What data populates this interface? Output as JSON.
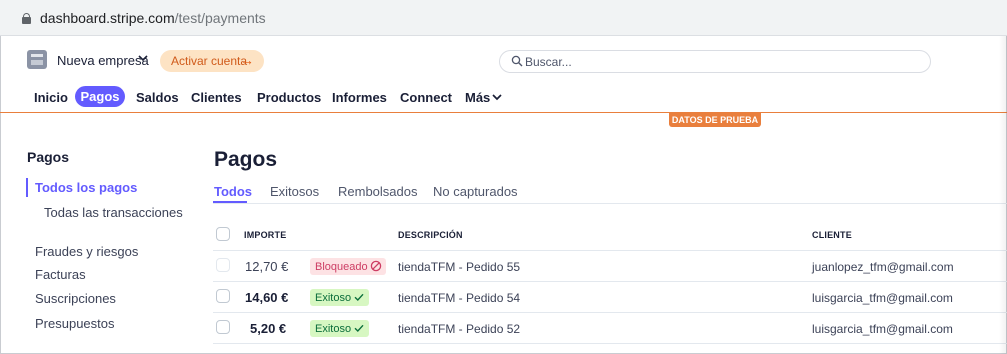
{
  "browser": {
    "url_host": "dashboard.stripe.com",
    "url_path": "/test/payments"
  },
  "topbar": {
    "business_name": "Nueva empresa",
    "activate_label": "Activar cuenta",
    "activate_arrow": "→",
    "search_placeholder": "Buscar..."
  },
  "nav": {
    "items": [
      "Inicio",
      "Pagos",
      "Saldos",
      "Clientes",
      "Productos",
      "Informes",
      "Connect",
      "Más"
    ],
    "active": "Pagos",
    "test_badge": "DATOS DE PRUEBA"
  },
  "sidebar": {
    "heading": "Pagos",
    "items": [
      "Todos los pagos",
      "Todas las transacciones",
      "Fraudes y riesgos",
      "Facturas",
      "Suscripciones",
      "Presupuestos"
    ],
    "active": "Todos los pagos"
  },
  "main": {
    "title": "Pagos",
    "tabs": [
      "Todos",
      "Exitosos",
      "Rembolsados",
      "No capturados"
    ],
    "active_tab": "Todos",
    "columns": [
      "IMPORTE",
      "DESCRIPCIÓN",
      "CLIENTE"
    ],
    "rows": [
      {
        "amount": "12,70 €",
        "status": "Bloqueado",
        "status_type": "blocked",
        "description": "tiendaTFM - Pedido 55",
        "customer": "juanlopez_tfm@gmail.com"
      },
      {
        "amount": "14,60 €",
        "status": "Exitoso",
        "status_type": "success",
        "description": "tiendaTFM - Pedido 54",
        "customer": "luisgarcia_tfm@gmail.com"
      },
      {
        "amount": "5,20 €",
        "status": "Exitoso",
        "status_type": "success",
        "description": "tiendaTFM - Pedido 52",
        "customer": "luisgarcia_tfm@gmail.com"
      }
    ]
  },
  "colors": {
    "accent": "#635bff",
    "test_mode": "#e97f3d",
    "blocked_bg": "#fde2e4",
    "success_bg": "#d7f7c2"
  },
  "icons": [
    "lock-icon",
    "business-icon",
    "chevron-down-icon",
    "arrow-right-icon",
    "search-icon",
    "blocked-icon",
    "check-icon"
  ]
}
